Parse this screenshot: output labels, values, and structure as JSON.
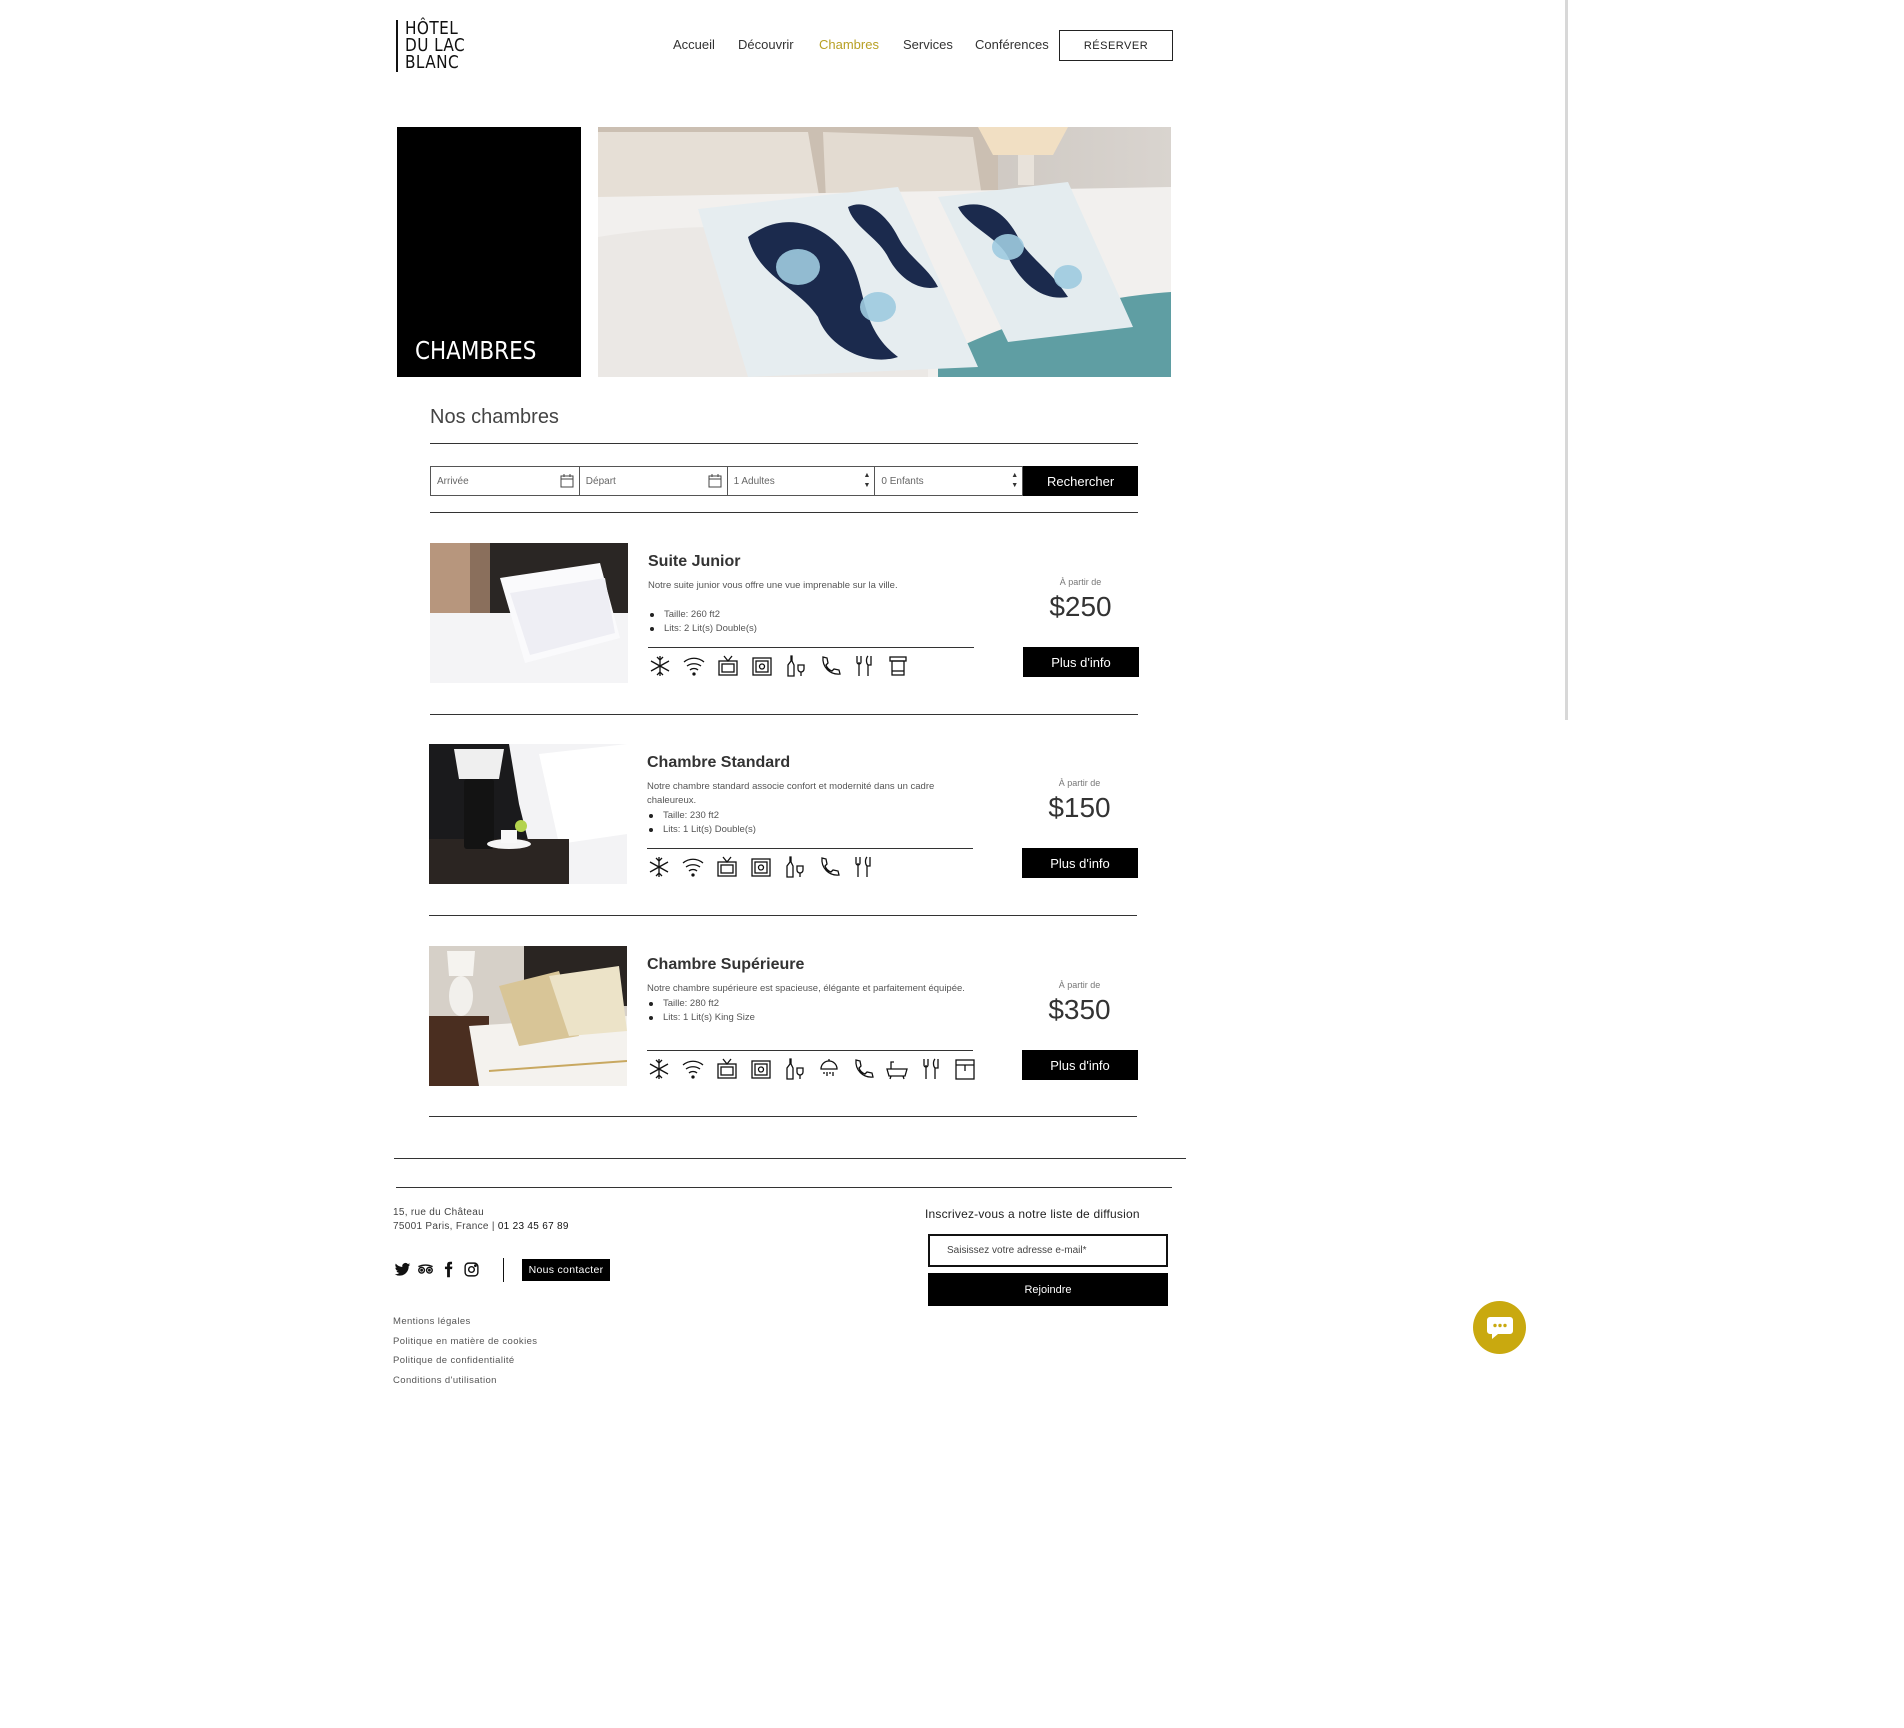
{
  "brand": {
    "logo_lines": [
      "HÔTEL",
      "DU LAC",
      "BLANC"
    ]
  },
  "nav": {
    "items": [
      {
        "label": "Accueil",
        "active": false
      },
      {
        "label": "Découvrir",
        "active": false
      },
      {
        "label": "Chambres",
        "active": true
      },
      {
        "label": "Services",
        "active": false
      },
      {
        "label": "Conférences",
        "active": false
      }
    ],
    "reserve_label": "RÉSERVER",
    "active_color": "#b8a024"
  },
  "hero": {
    "title": "CHAMBRES"
  },
  "rooms_section": {
    "title": "Nos chambres",
    "search": {
      "arrival_placeholder": "Arrivée",
      "departure_placeholder": "Départ",
      "adults_value": "1 Adultes",
      "children_value": "0 Enfants",
      "button_label": "Rechercher"
    }
  },
  "rooms": [
    {
      "name": "Suite Junior",
      "description": "Notre suite junior vous offre une vue imprenable sur la ville.",
      "size": "Taille: 260 ft2",
      "beds": "Lits: 2 Lit(s) Double(s)",
      "from_label": "À partir de",
      "price": "$250",
      "button_label": "Plus d'info",
      "amenities": [
        "snowflake-icon",
        "wifi-icon",
        "tv-icon",
        "safe-icon",
        "minibar-icon",
        "phone-icon",
        "restaurant-icon",
        "towel-icon"
      ]
    },
    {
      "name": "Chambre Standard",
      "description": "Notre chambre standard associe confort et modernité dans un cadre chaleureux.",
      "size": "Taille: 230 ft2",
      "beds": "Lits: 1 Lit(s) Double(s)",
      "from_label": "À partir de",
      "price": "$150",
      "button_label": "Plus d'info",
      "amenities": [
        "snowflake-icon",
        "wifi-icon",
        "tv-icon",
        "safe-icon",
        "minibar-icon",
        "phone-icon",
        "restaurant-icon"
      ]
    },
    {
      "name": "Chambre Supérieure",
      "description": "Notre chambre supérieure est spacieuse, élégante et parfaitement équipée.",
      "size": "Taille: 280 ft2",
      "beds": "Lits: 1 Lit(s) King Size",
      "from_label": "À partir de",
      "price": "$350",
      "button_label": "Plus d'info",
      "amenities": [
        "snowflake-icon",
        "wifi-icon",
        "tv-icon",
        "safe-icon",
        "minibar-icon",
        "shower-icon",
        "phone-icon",
        "bathtub-icon",
        "restaurant-icon",
        "balcony-icon"
      ]
    }
  ],
  "footer": {
    "address_line1": "15, rue du Château",
    "address_line2": "75001 Paris, France | ",
    "phone": "01 23 45 67 89",
    "social": [
      "twitter-icon",
      "tripadvisor-icon",
      "facebook-icon",
      "instagram-icon"
    ],
    "contact_label": "Nous contacter",
    "links": [
      "Mentions légales",
      "Politique en matière de cookies",
      "Politique de confidentialité",
      "Conditions d'utilisation"
    ],
    "newsletter_title": "Inscrivez-vous a notre liste de diffusion",
    "newsletter_placeholder": "Saisissez votre adresse e-mail*",
    "newsletter_button": "Rejoindre"
  },
  "chat": {
    "icon": "chat-bubble-icon",
    "color": "#c9a90f"
  }
}
